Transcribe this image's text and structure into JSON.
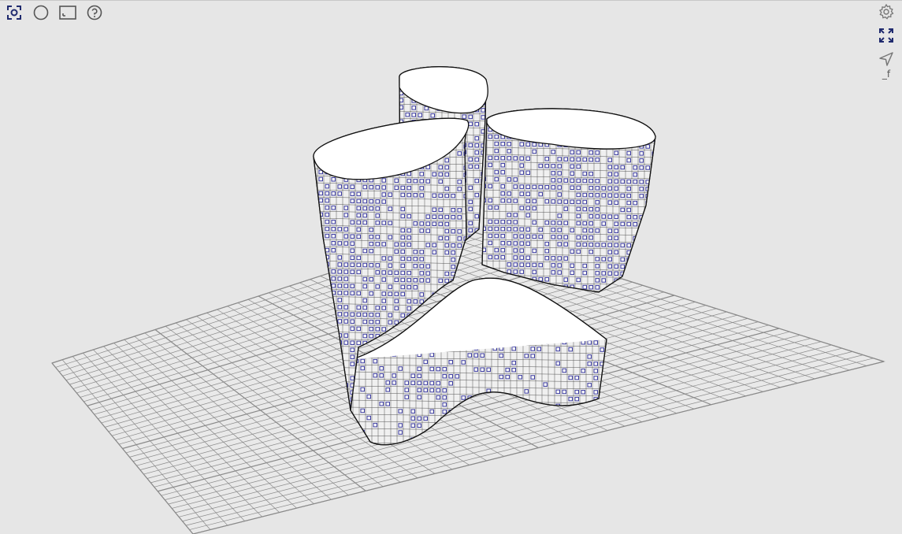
{
  "viewer": {
    "background": "#e6e6e6",
    "grid_color": "#8a8a8a",
    "tower_top_fill": "#ffffff",
    "tower_wall_fill": "#f0f0f0",
    "window_color": "#3c3ca0",
    "accent": "#1f2a6e"
  },
  "toolbar_left": [
    {
      "icon": "zoom-extents-icon",
      "active": true
    },
    {
      "icon": "circle-shape-icon"
    },
    {
      "icon": "frame-icon"
    },
    {
      "icon": "help-icon"
    }
  ],
  "toolbar_right": {
    "settings_icon": "gear-icon",
    "fullscreen_icon": "expand-icon",
    "navigate_icon": "send-arrow-icon",
    "label": "_f"
  }
}
